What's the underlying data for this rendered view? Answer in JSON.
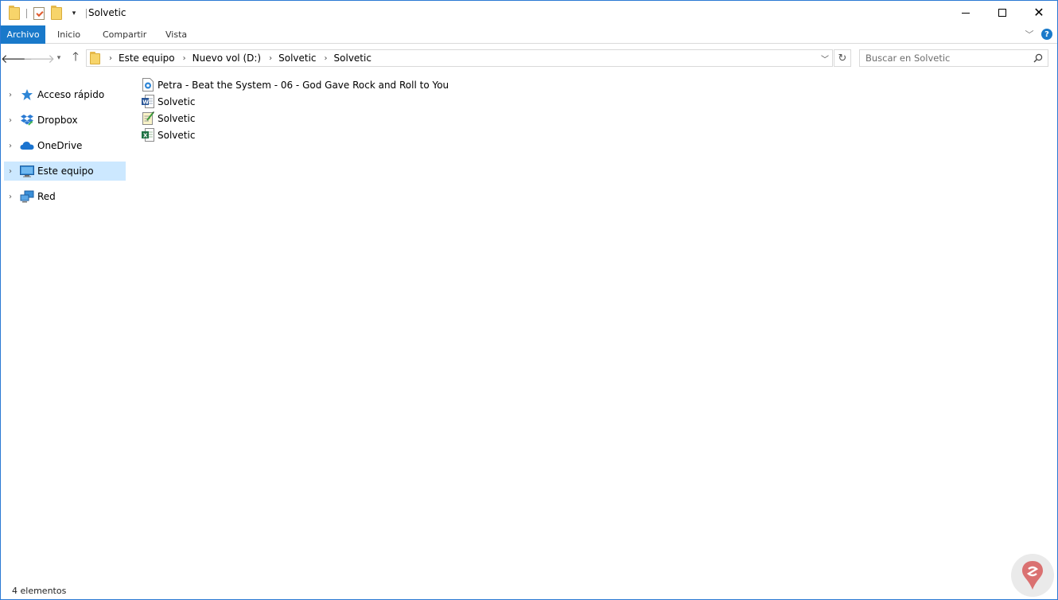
{
  "window": {
    "title": "Solvetic",
    "controls": {
      "minimize": "minimize-icon",
      "maximize": "maximize-icon",
      "close": "close-icon"
    }
  },
  "quick_access_toolbar": {
    "items": [
      "folder-icon",
      "properties-check-icon",
      "new-folder-icon",
      "customize-dropdown-icon"
    ]
  },
  "ribbon": {
    "tabs": [
      "Archivo",
      "Inicio",
      "Compartir",
      "Vista"
    ],
    "active_tab": "Archivo",
    "accent_color": "#1979ca"
  },
  "navigation": {
    "back": "back-arrow-icon",
    "forward": "forward-arrow-icon",
    "recent": "recent-locations-icon",
    "up": "up-arrow-icon",
    "breadcrumb": [
      "Este equipo",
      "Nuevo vol (D:)",
      "Solvetic",
      "Solvetic"
    ],
    "refresh": "refresh-icon",
    "search_placeholder": "Buscar en Solvetic"
  },
  "sidebar": {
    "items": [
      {
        "label": "Acceso rápido",
        "icon": "star-icon",
        "selected": false
      },
      {
        "label": "Dropbox",
        "icon": "dropbox-icon",
        "selected": false
      },
      {
        "label": "OneDrive",
        "icon": "onedrive-cloud-icon",
        "selected": false
      },
      {
        "label": "Este equipo",
        "icon": "computer-icon",
        "selected": true
      },
      {
        "label": "Red",
        "icon": "network-icon",
        "selected": false
      }
    ],
    "selected_color": "#cce8ff"
  },
  "files": [
    {
      "name": "Petra - Beat the System - 06 - God Gave Rock and Roll to You",
      "icon": "audio-file-icon"
    },
    {
      "name": "Solvetic",
      "icon": "word-document-icon"
    },
    {
      "name": "Solvetic",
      "icon": "text-document-icon"
    },
    {
      "name": "Solvetic",
      "icon": "excel-spreadsheet-icon"
    }
  ],
  "status": {
    "count_text": "4 elementos"
  }
}
